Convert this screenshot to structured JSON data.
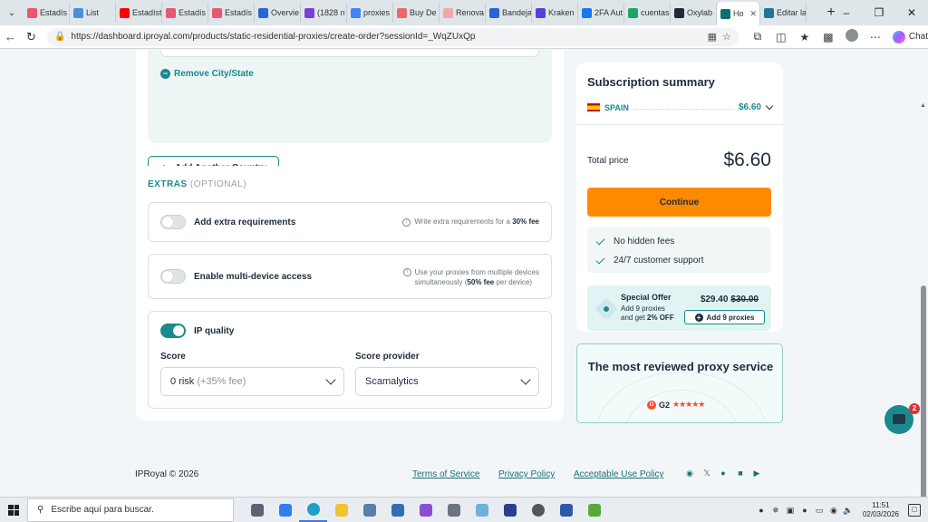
{
  "browser": {
    "tabs": [
      {
        "label": "Estadís",
        "color": "#e8566f"
      },
      {
        "label": "List",
        "color": "#4a90d9"
      },
      {
        "label": "Estadíst",
        "color": "#ff0000"
      },
      {
        "label": "Estadís",
        "color": "#e8566f"
      },
      {
        "label": "Estadís",
        "color": "#e8566f"
      },
      {
        "label": "Overvie",
        "color": "#2a62d9"
      },
      {
        "label": "(1828 n",
        "color": "#7b3fd1"
      },
      {
        "label": "proxies",
        "color": "#4285f4"
      },
      {
        "label": "Buy De",
        "color": "#e86a6a"
      },
      {
        "label": "Renova",
        "color": "#f2a6a6"
      },
      {
        "label": "Bandeja",
        "color": "#2a62d9"
      },
      {
        "label": "Kraken",
        "color": "#5741d9"
      },
      {
        "label": "2FA Aut",
        "color": "#1877f2"
      },
      {
        "label": "cuentas",
        "color": "#1fa463"
      },
      {
        "label": "Oxylab",
        "color": "#1e2a38"
      },
      {
        "label": "Ho",
        "color": "#0e6e70"
      },
      {
        "label": "Editar la",
        "color": "#21759b"
      }
    ],
    "active_tab_index": 15,
    "url": "https://dashboard.iproyal.com/products/static-residential-proxies/create-order?sessionId=_WqZUxQp",
    "chat_label": "Chat"
  },
  "order": {
    "remove_city_label": "Remove City/State",
    "add_country_label": "Add Another Country"
  },
  "extras": {
    "title": "EXTRAS",
    "optional": "(OPTIONAL)",
    "extra_requirements": {
      "label": "Add extra requirements",
      "hint_prefix": "Write extra requirements for a ",
      "hint_bold": "30% fee",
      "enabled": false
    },
    "multi_device": {
      "label": "Enable multi-device access",
      "hint_line1": "Use your proxies from multiple devices",
      "hint_line2_prefix": "simultaneously (",
      "hint_bold": "50% fee",
      "hint_suffix": " per device)",
      "enabled": false
    },
    "ip_quality": {
      "label": "IP quality",
      "enabled": true,
      "score_label": "Score",
      "score_value": "0 risk",
      "score_fee": "(+35% fee)",
      "provider_label": "Score provider",
      "provider_value": "Scamalytics"
    }
  },
  "summary": {
    "title": "Subscription summary",
    "country": "SPAIN",
    "country_price": "$6.60",
    "total_label": "Total price",
    "total_value": "$6.60",
    "continue_label": "Continue",
    "perks": [
      "No hidden fees",
      "24/7 customer support"
    ],
    "offer": {
      "title": "Special Offer",
      "desc_line1": "Add 9 proxies",
      "desc_line2_prefix": "and get ",
      "desc_bold": "2% OFF",
      "price": "$29.40",
      "old_price": "$30.00",
      "button_label": "Add 9 proxies"
    }
  },
  "review": {
    "title": "The most reviewed proxy service",
    "g2_label": "G2",
    "stars": "★★★★★",
    "rating_stars": 4.5
  },
  "footer": {
    "copyright": "IPRoyal © 2026",
    "links": [
      "Terms of Service",
      "Privacy Policy",
      "Acceptable Use Policy"
    ],
    "chat_badge": "2"
  },
  "taskbar": {
    "search_placeholder": "Escribe aquí para buscar.",
    "time": "11:51",
    "date": "02/03/2026"
  },
  "colors": {
    "accent": "#1b8a8e",
    "continue": "#ff8a00"
  }
}
